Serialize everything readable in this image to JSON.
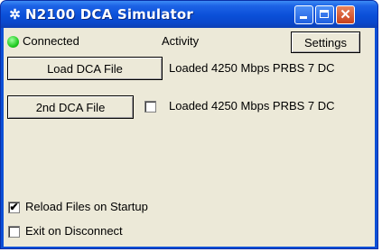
{
  "window": {
    "title": "N2100 DCA Simulator",
    "app_icon": "✲"
  },
  "status": {
    "connected_label": "Connected",
    "led_color": "#22cc22",
    "activity_label": "Activity"
  },
  "buttons": {
    "settings": "Settings",
    "load_dca": "Load DCA File",
    "second_dca": "2nd DCA File"
  },
  "files": {
    "loaded_primary": "Loaded 4250 Mbps PRBS 7 DC",
    "second_enabled": false,
    "loaded_secondary": "Loaded 4250 Mbps PRBS 7 DC"
  },
  "options": {
    "reload_checked": true,
    "reload_label": "Reload Files on Startup",
    "exit_checked": false,
    "exit_label": "Exit on Disconnect"
  }
}
